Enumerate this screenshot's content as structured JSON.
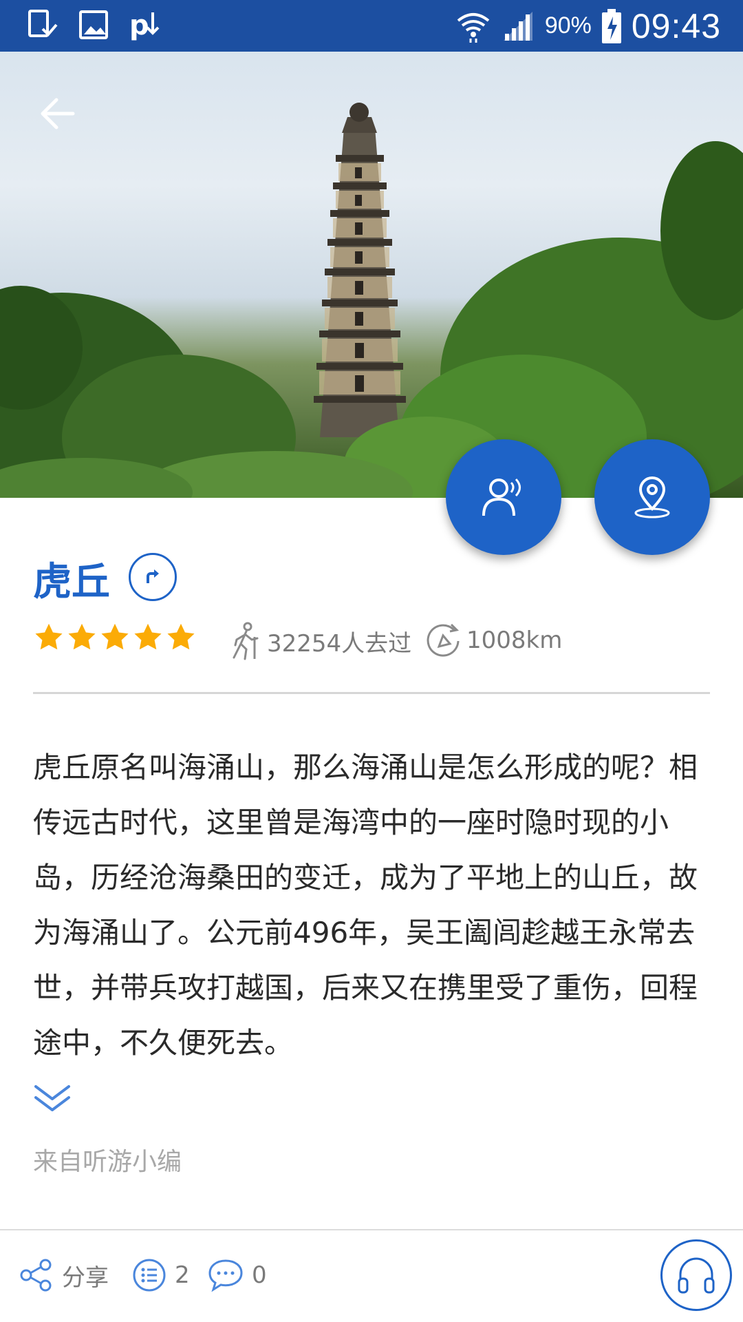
{
  "status_bar": {
    "battery": "90%",
    "time": "09:43"
  },
  "spot": {
    "title": "虎丘",
    "rating_stars": 5,
    "visitors": "32254人去过",
    "distance": "1008km",
    "description": "虎丘原名叫海涌山，那么海涌山是怎么形成的呢？相传远古时代，这里曾是海湾中的一座时隐时现的小岛，历经沧海桑田的变迁，成为了平地上的山丘，故为海涌山了。公元前496年，吴王阖闾趁越王永常去世，并带兵攻打越国，后来又在携里受了重伤，回程途中，不久便死去。",
    "source": "来自听游小编"
  },
  "bottom_bar": {
    "share_label": "分享",
    "list_count": "2",
    "comment_count": "0"
  },
  "icons": {
    "back": "arrow-left-icon",
    "audio_guide": "speaking-person-icon",
    "location": "map-pin-icon",
    "route": "route-arrow-icon",
    "visitors": "walking-person-icon",
    "distance": "compass-icon",
    "expand": "double-chevron-down-icon",
    "share": "share-icon",
    "list": "list-icon",
    "comment": "comment-icon",
    "listen": "headphones-icon"
  },
  "colors": {
    "status_bar": "#1c4fa1",
    "accent": "#1e63c7",
    "star": "#fbab06",
    "muted_text": "#7a7a7a"
  }
}
